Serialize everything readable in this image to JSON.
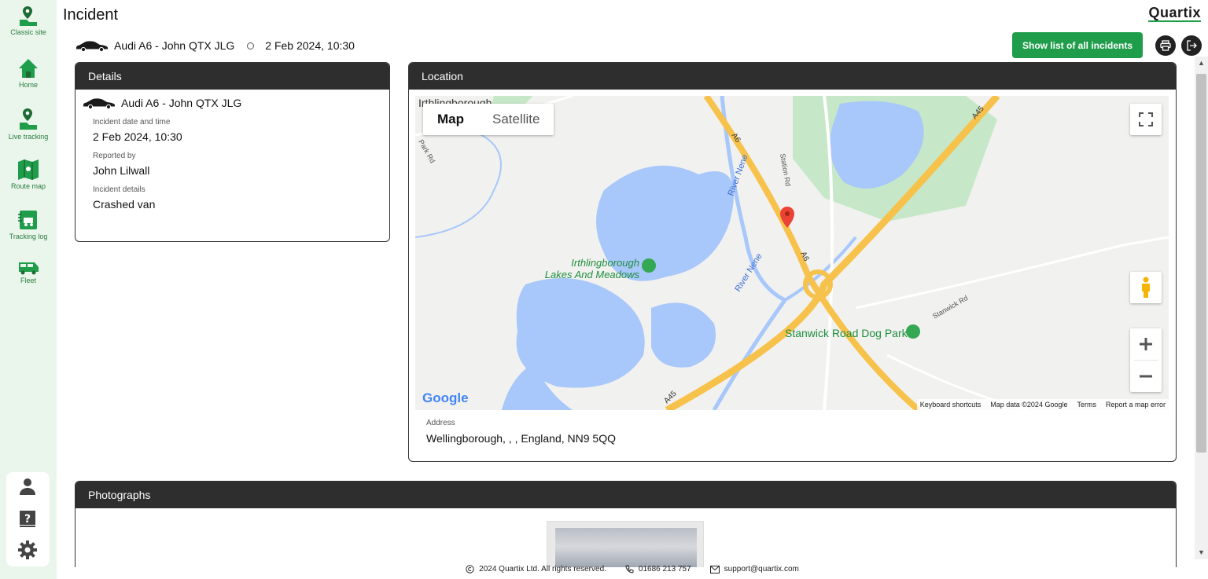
{
  "sidebar": {
    "items": [
      {
        "label": "Classic site",
        "icon": "map-pin-icon"
      },
      {
        "label": "Home",
        "icon": "home-icon"
      },
      {
        "label": "Live tracking",
        "icon": "live-tracking-icon"
      },
      {
        "label": "Route map",
        "icon": "route-map-icon"
      },
      {
        "label": "Tracking log",
        "icon": "tracking-log-icon"
      },
      {
        "label": "Fleet",
        "icon": "fleet-icon"
      }
    ],
    "bottom_icons": [
      "user-icon",
      "help-icon",
      "settings-icon"
    ]
  },
  "header": {
    "title": "Incident",
    "brand": "Quartix",
    "vehicle": "Audi A6 - John QTX JLG",
    "datetime": "2 Feb 2024, 10:30",
    "show_list_label": "Show list of all incidents",
    "print_icon": "printer-icon",
    "exit_icon": "exit-icon"
  },
  "details": {
    "heading": "Details",
    "vehicle": "Audi A6 - John QTX JLG",
    "date_label": "Incident date and time",
    "date_value": "2 Feb 2024, 10:30",
    "reported_label": "Reported by",
    "reported_value": "John Lilwall",
    "incident_label": "Incident details",
    "incident_value": "Crashed van"
  },
  "location": {
    "heading": "Location",
    "map_tabs": [
      "Map",
      "Satellite"
    ],
    "active_tab": "Map",
    "map_labels": {
      "place1": "Irthlingborough",
      "place2": "Lakes And Meadows",
      "river1": "River Nene",
      "river2": "River Nene",
      "road_a6": "A6",
      "road_a45": "A45",
      "station_rd": "Station Rd",
      "stanwick_rd": "Stanwick Rd",
      "park_rd": "Park Rd",
      "dog_park": "Stanwick Road Dog Park",
      "top_label": "Irthlingborough"
    },
    "footer_links": [
      "Keyboard shortcuts",
      "Map data ©2024 Google",
      "Terms",
      "Report a map error"
    ],
    "google_logo": "Google",
    "address_label": "Address",
    "address_value": "Wellingborough, , , England, NN9 5QQ",
    "colors": {
      "water": "#a8c7fa",
      "park": "#c6e8c8",
      "road_major": "#f7c24b",
      "marker": "#ea4335"
    }
  },
  "photographs": {
    "heading": "Photographs"
  },
  "footer": {
    "copyright": "2024 Quartix Ltd. All rights reserved.",
    "phone": "01686 213 757",
    "email": "support@quartix.com"
  },
  "colors": {
    "accent": "#1f9d4b",
    "sidebar_bg": "#eaf6ec",
    "panel_head": "#2e2e2e"
  }
}
